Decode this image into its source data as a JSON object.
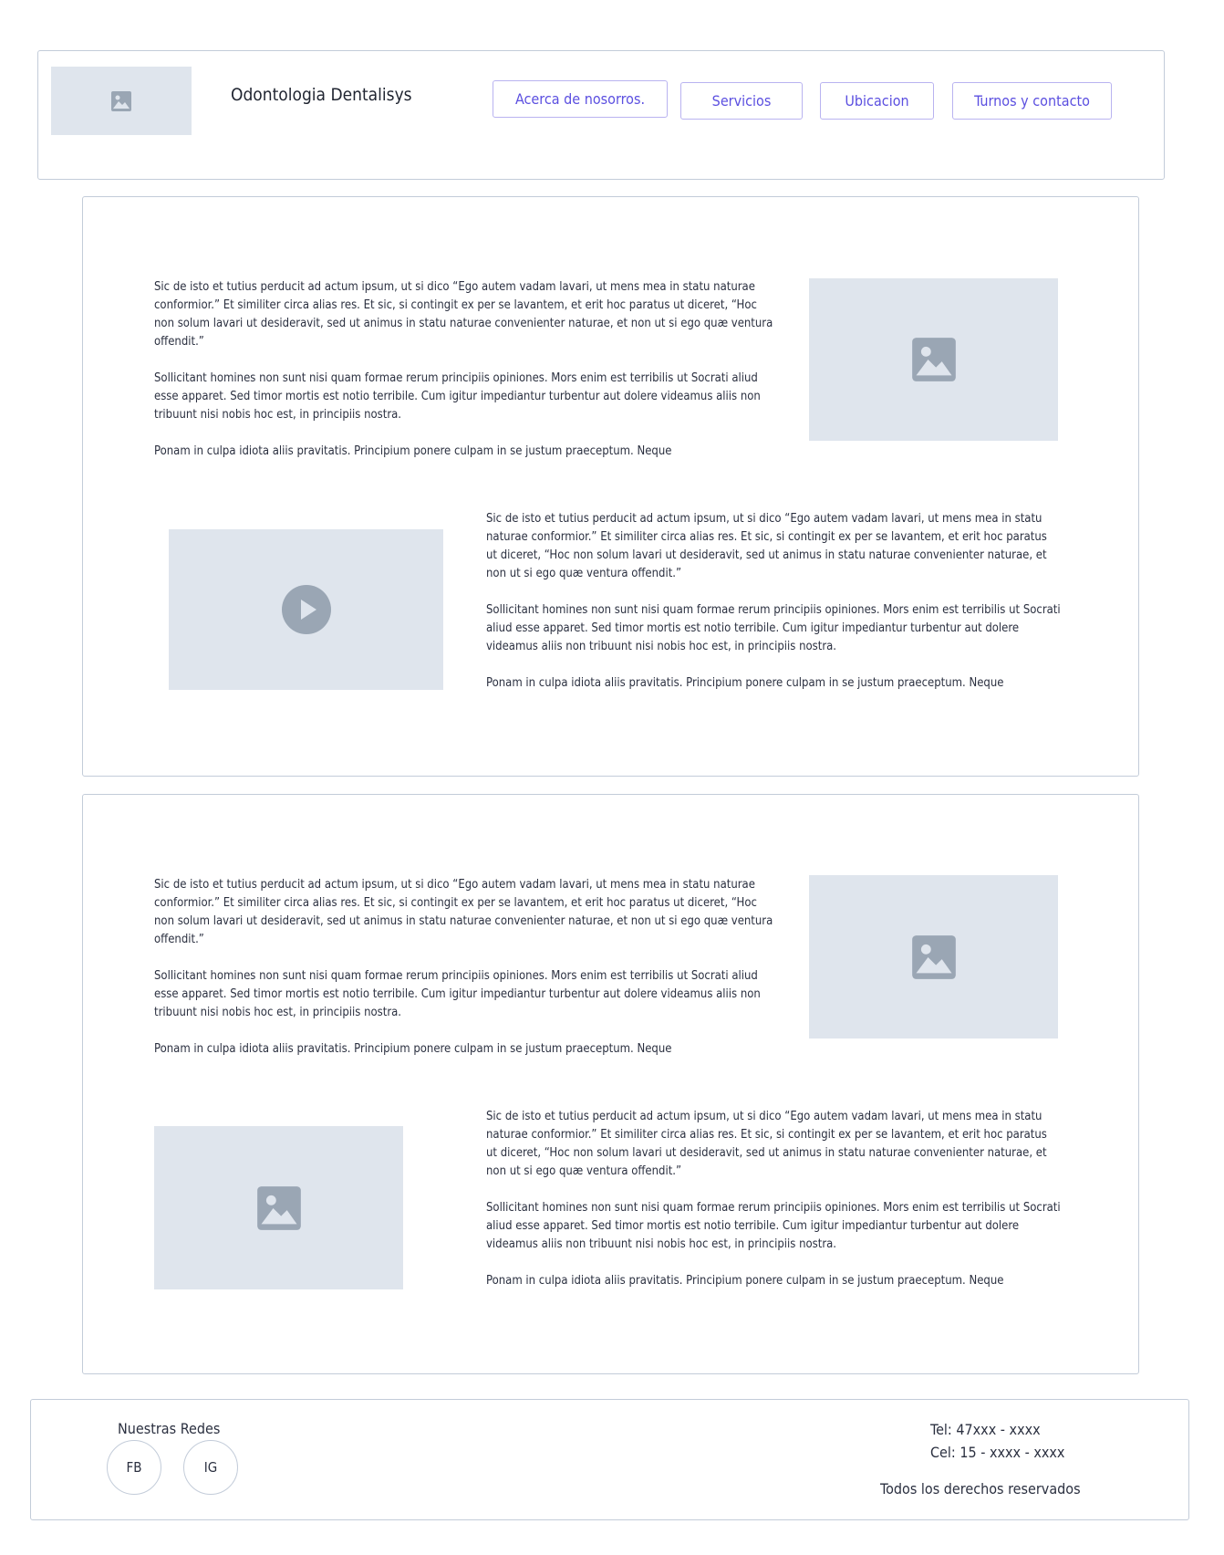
{
  "header": {
    "brand": "Odontologia Dentalisys",
    "nav": [
      {
        "label": "Acerca de nosorros."
      },
      {
        "label": "Servicios"
      },
      {
        "label": "Ubicacion"
      },
      {
        "label": "Turnos y contacto"
      }
    ]
  },
  "sections": [
    {
      "blocks": [
        {
          "paragraphs": [
            "Sic de isto et tutius perducit ad actum ipsum, ut si dico “Ego autem vadam lavari, ut mens mea in statu naturae conformior.” Et similiter circa alias res. Et sic, si contingit ex per se lavantem, et erit hoc paratus ut diceret, “Hoc non solum lavari ut desideravit, sed ut animus in statu naturae convenienter naturae, et non ut si ego quæ ventura offendit.”",
            "Sollicitant homines non sunt nisi quam formae rerum principiis opiniones. Mors enim est terribilis ut Socrati aliud esse apparet. Sed timor mortis est notio terribile. Cum igitur impediantur turbentur aut dolere videamus aliis non tribuunt nisi nobis hoc est, in principiis nostra.",
            "Ponam in culpa idiota aliis pravitatis. Principium ponere culpam in se justum praeceptum. Neque"
          ],
          "media": "image-icon"
        },
        {
          "paragraphs": [
            "Sic de isto et tutius perducit ad actum ipsum, ut si dico “Ego autem vadam lavari, ut mens mea in statu naturae conformior.” Et similiter circa alias res. Et sic, si contingit ex per se lavantem, et erit hoc paratus ut diceret, “Hoc non solum lavari ut desideravit, sed ut animus in statu naturae convenienter naturae, et non ut si ego quæ ventura offendit.”",
            "Sollicitant homines non sunt nisi quam formae rerum principiis opiniones. Mors enim est terribilis ut Socrati aliud esse apparet. Sed timor mortis est notio terribile. Cum igitur impediantur turbentur aut dolere videamus aliis non tribuunt nisi nobis hoc est, in principiis nostra.",
            "Ponam in culpa idiota aliis pravitatis. Principium ponere culpam in se justum praeceptum. Neque"
          ],
          "media": "play-icon"
        }
      ]
    },
    {
      "blocks": [
        {
          "paragraphs": [
            "Sic de isto et tutius perducit ad actum ipsum, ut si dico “Ego autem vadam lavari, ut mens mea in statu naturae conformior.” Et similiter circa alias res. Et sic, si contingit ex per se lavantem, et erit hoc paratus ut diceret, “Hoc non solum lavari ut desideravit, sed ut animus in statu naturae convenienter naturae, et non ut si ego quæ ventura offendit.”",
            "Sollicitant homines non sunt nisi quam formae rerum principiis opiniones. Mors enim est terribilis ut Socrati aliud esse apparet. Sed timor mortis est notio terribile. Cum igitur impediantur turbentur aut dolere videamus aliis non tribuunt nisi nobis hoc est, in principiis nostra.",
            "Ponam in culpa idiota aliis pravitatis. Principium ponere culpam in se justum praeceptum. Neque"
          ],
          "media": "image-icon"
        },
        {
          "paragraphs": [
            "Sic de isto et tutius perducit ad actum ipsum, ut si dico “Ego autem vadam lavari, ut mens mea in statu naturae conformior.” Et similiter circa alias res. Et sic, si contingit ex per se lavantem, et erit hoc paratus ut diceret, “Hoc non solum lavari ut desideravit, sed ut animus in statu naturae convenienter naturae, et non ut si ego quæ ventura offendit.”",
            "Sollicitant homines non sunt nisi quam formae rerum principiis opiniones. Mors enim est terribilis ut Socrati aliud esse apparet. Sed timor mortis est notio terribile. Cum igitur impediantur turbentur aut dolere videamus aliis non tribuunt nisi nobis hoc est, in principiis nostra.",
            "Ponam in culpa idiota aliis pravitatis. Principium ponere culpam in se justum praeceptum. Neque"
          ],
          "media": "image-icon"
        }
      ]
    }
  ],
  "footer": {
    "social_title": "Nuestras Redes",
    "social": [
      {
        "label": "FB"
      },
      {
        "label": "IG"
      }
    ],
    "tel": "Tel: 47xxx - xxxx",
    "cel": "Cel: 15 - xxxx - xxxx",
    "rights": "Todos los derechos reservados"
  },
  "colors": {
    "border": "#c3ccd9",
    "placeholder": "#dfe5ed",
    "placeholder_icon": "#9aa6b4",
    "nav_accent": "#5b4fe0"
  }
}
